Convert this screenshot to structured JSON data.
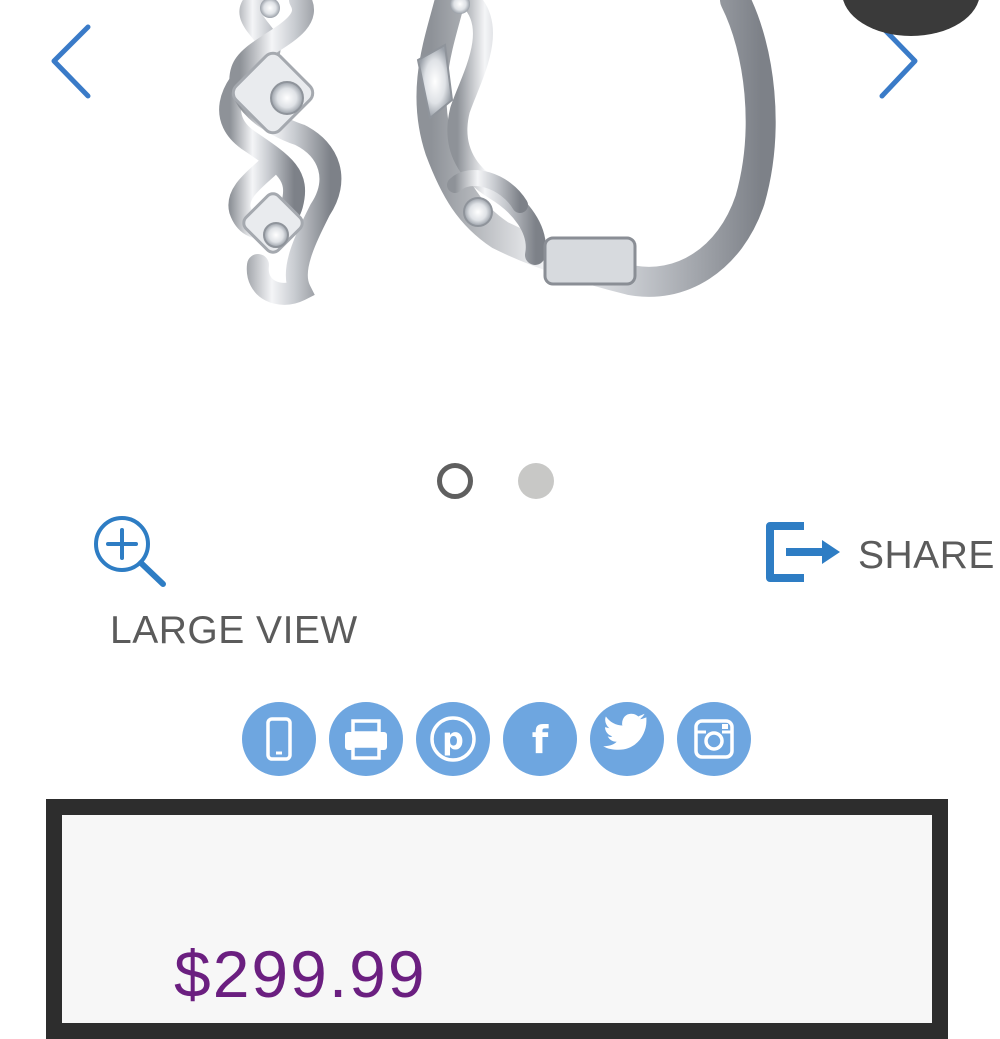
{
  "product": {
    "image_description_icon": "earring-icon",
    "nav": {
      "prev_icon": "chevron-left-icon",
      "next_icon": "chevron-right-icon"
    },
    "carousel": {
      "slides": 2,
      "active": 1
    }
  },
  "actions": {
    "large_view_label": "LARGE VIEW",
    "large_view_icon": "zoom-in-icon",
    "share_label": "SHARE",
    "share_icon": "share-export-icon"
  },
  "social": [
    {
      "name": "phone",
      "icon": "phone-icon"
    },
    {
      "name": "print",
      "icon": "printer-icon"
    },
    {
      "name": "pinterest",
      "icon": "pinterest-icon",
      "glyph": "p"
    },
    {
      "name": "facebook",
      "icon": "facebook-icon",
      "glyph": "f"
    },
    {
      "name": "twitter",
      "icon": "twitter-icon"
    },
    {
      "name": "instagram",
      "icon": "instagram-icon"
    }
  ],
  "price": {
    "amount": "$299.99"
  },
  "colors": {
    "accent_blue": "#2e7dc4",
    "social_blue": "#6ea6e0",
    "price_purple": "#6b1f80",
    "text_gray": "#5b5b5b"
  }
}
